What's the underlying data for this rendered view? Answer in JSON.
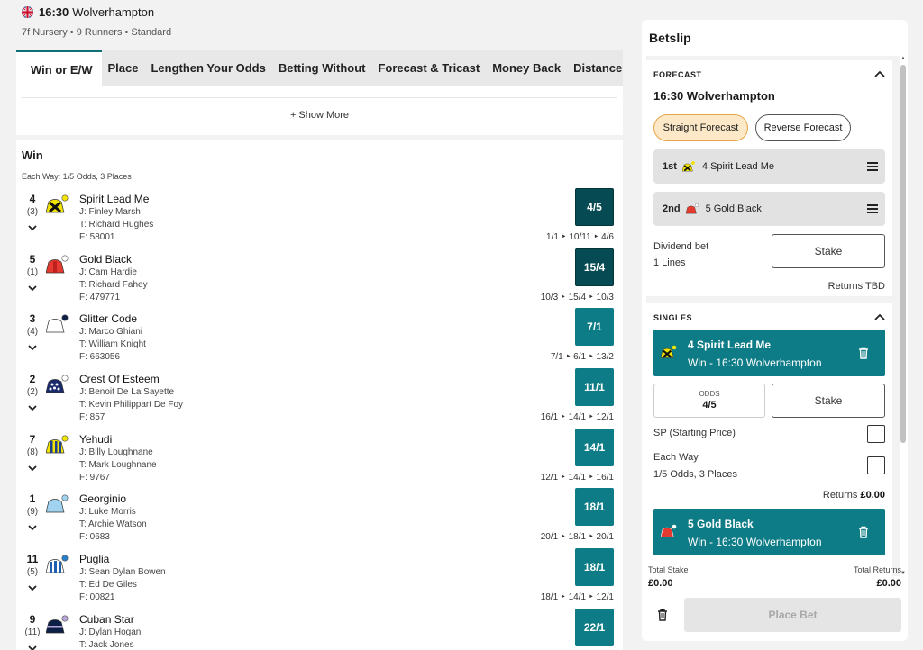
{
  "race": {
    "time": "16:30",
    "course": "Wolverhampton",
    "details": "7f Nursery • 9 Runners • Standard"
  },
  "tabs": [
    "Win or E/W",
    "Place",
    "Lengthen Your Odds",
    "Betting Without",
    "Forecast & Tricast",
    "Money Back",
    "Distance"
  ],
  "show_more": "+ Show More",
  "win_section": {
    "title": "Win",
    "each_way_terms": "Each Way: 1/5 Odds, 3 Places"
  },
  "runners": [
    {
      "number": "4",
      "draw": "(3)",
      "name": "Spirit Lead Me",
      "jockey": "J: Finley Marsh",
      "trainer": "T: Richard Hughes",
      "form": "F: 58001",
      "odds": "4/5",
      "history": "1/1 ‣ 10/11 ‣ 4/6",
      "selected": true
    },
    {
      "number": "5",
      "draw": "(1)",
      "name": "Gold Black",
      "jockey": "J: Cam Hardie",
      "trainer": "T: Richard Fahey",
      "form": "F: 479771",
      "odds": "15/4",
      "history": "10/3 ‣ 15/4 ‣ 10/3",
      "selected": true
    },
    {
      "number": "3",
      "draw": "(4)",
      "name": "Glitter Code",
      "jockey": "J: Marco Ghiani",
      "trainer": "T: William Knight",
      "form": "F: 663056",
      "odds": "7/1",
      "history": "7/1 ‣ 6/1 ‣ 13/2",
      "selected": false
    },
    {
      "number": "2",
      "draw": "(2)",
      "name": "Crest Of Esteem",
      "jockey": "J: Benoit De La Sayette",
      "trainer": "T: Kevin Philippart De Foy",
      "form": "F: 857",
      "odds": "11/1",
      "history": "16/1 ‣ 14/1 ‣ 12/1",
      "selected": false
    },
    {
      "number": "7",
      "draw": "(8)",
      "name": "Yehudi",
      "jockey": "J: Billy Loughnane",
      "trainer": "T: Mark Loughnane",
      "form": "F: 9767",
      "odds": "14/1",
      "history": "12/1 ‣ 14/1 ‣ 16/1",
      "selected": false
    },
    {
      "number": "1",
      "draw": "(9)",
      "name": "Georginio",
      "jockey": "J: Luke Morris",
      "trainer": "T: Archie Watson",
      "form": "F: 0683",
      "odds": "18/1",
      "history": "20/1 ‣ 18/1 ‣ 20/1",
      "selected": false
    },
    {
      "number": "11",
      "draw": "(5)",
      "name": "Puglia",
      "jockey": "J: Sean Dylan Bowen",
      "trainer": "T: Ed De Giles",
      "form": "F: 00821",
      "odds": "18/1",
      "history": "18/1 ‣ 14/1 ‣ 12/1",
      "selected": false
    },
    {
      "number": "9",
      "draw": "(11)",
      "name": "Cuban Star",
      "jockey": "J: Dylan Hogan",
      "trainer": "T: Jack Jones",
      "form": "",
      "odds": "22/1",
      "history": "",
      "selected": false
    }
  ],
  "betslip": {
    "title": "Betslip",
    "forecast": {
      "label": "FORECAST",
      "race": "16:30 Wolverhampton",
      "straight": "Straight Forecast",
      "reverse": "Reverse Forecast",
      "first_pos": "1st",
      "first_runner": "4 Spirit Lead Me",
      "second_pos": "2nd",
      "second_runner": "5 Gold Black",
      "dividend_label": "Dividend bet",
      "lines": "1 Lines",
      "stake_placeholder": "Stake",
      "returns": "Returns TBD"
    },
    "singles": {
      "label": "SINGLES",
      "sel1_name": "4 Spirit Lead Me",
      "sel1_market": "Win - 16:30 Wolverhampton",
      "odds_label": "ODDS",
      "odds_value": "4/5",
      "stake_placeholder": "Stake",
      "sp_label": "SP (Starting Price)",
      "ew_label": "Each Way",
      "ew_terms": "1/5 Odds, 3 Places",
      "returns_label": "Returns",
      "returns_value": "£0.00",
      "sel2_name": "5 Gold Black",
      "sel2_market": "Win - 16:30 Wolverhampton"
    },
    "footer": {
      "total_stake_label": "Total Stake",
      "total_stake": "£0.00",
      "total_returns_label": "Total Returns",
      "total_returns": "£0.00",
      "place_bet": "Place Bet"
    }
  },
  "colors": {
    "accent": "#0e7c86",
    "accent_dark": "#064b54",
    "pill_active_bg": "#fde9c8",
    "pill_active_border": "#e8a447"
  }
}
